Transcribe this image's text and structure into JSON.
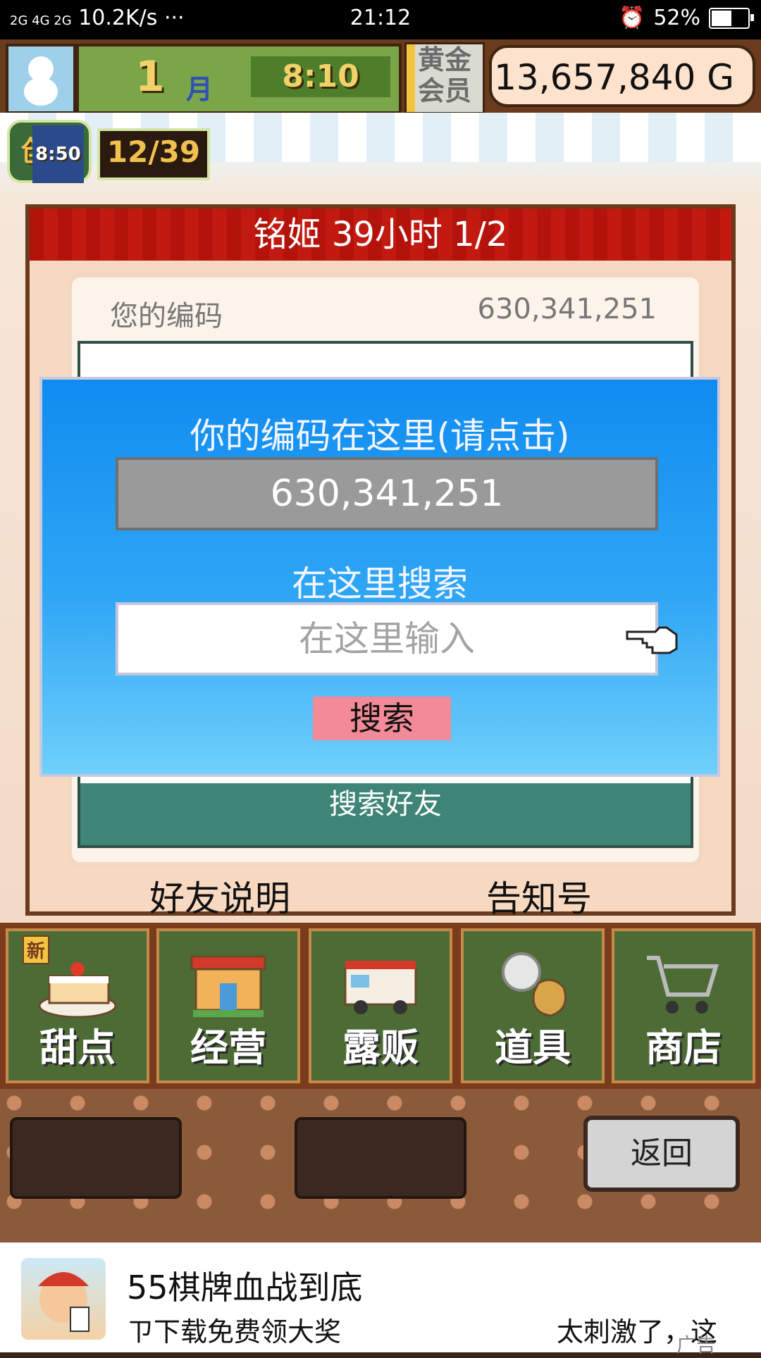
{
  "status_bar": {
    "signal": "2G 4G 2G",
    "speed": "10.2K/s",
    "dots": "···",
    "time": "21:12",
    "battery": "52%"
  },
  "hud": {
    "month_number": "1",
    "month_label": "月",
    "clock": "8:10",
    "member_line1": "黄金",
    "member_line2": "会员",
    "gold": "13,657,840 G"
  },
  "create_status": {
    "timer": "8:50",
    "label": "创作",
    "progress": "12/39"
  },
  "panel": {
    "header": "铭姬  39小时 1/2",
    "code_label": "您的编码",
    "code_value": "630,341,251",
    "friend_search_label": "搜索好友",
    "friend_info_link": "好友说明",
    "notice_link": "告知号"
  },
  "dialog": {
    "title": "你的编码在这里(请点击)",
    "code_value": "630,341,251",
    "search_title": "在这里搜索",
    "input_placeholder": "在这里输入",
    "search_button": "搜索"
  },
  "menu": {
    "new_tag": "新",
    "items": [
      {
        "label": "甜点",
        "icon": "cake-icon"
      },
      {
        "label": "经营",
        "icon": "shop-icon"
      },
      {
        "label": "露贩",
        "icon": "food-truck-icon"
      },
      {
        "label": "道具",
        "icon": "items-icon"
      },
      {
        "label": "商店",
        "icon": "cart-icon"
      }
    ]
  },
  "back_button": "返回",
  "ad": {
    "title": "55棋牌血战到底",
    "subtitle": "ㄗ下载免费领大奖",
    "cta": "太刺激了，这",
    "mark": "广告"
  }
}
